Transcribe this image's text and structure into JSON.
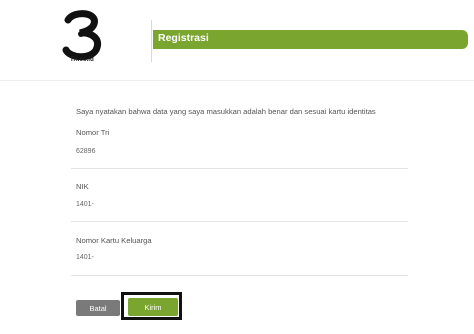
{
  "brand": {
    "logo_text": "Tri.co.id"
  },
  "header": {
    "title": "Registrasi"
  },
  "form": {
    "statement": "Saya nyatakan bahwa data yang saya masukkan adalah benar dan sesuai kartu identitas",
    "fields": [
      {
        "label": "Nomor Tri",
        "value": "62896"
      },
      {
        "label": "NIK",
        "value": "1401-"
      },
      {
        "label": "Nomor Kartu Keluarga",
        "value": "1401-"
      }
    ]
  },
  "buttons": {
    "cancel_label": "Batal",
    "submit_label": "Kirim"
  },
  "colors": {
    "accent": "#7aa52f",
    "cancel": "#7a7a7a"
  }
}
